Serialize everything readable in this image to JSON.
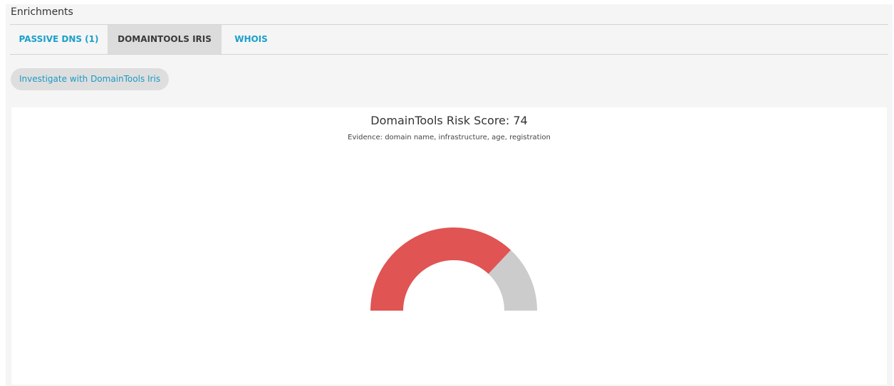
{
  "panel": {
    "title": "Enrichments"
  },
  "tabs": [
    {
      "label": "PASSIVE DNS (1)",
      "active": false
    },
    {
      "label": "DOMAINTOOLS IRIS",
      "active": true
    },
    {
      "label": "WHOIS",
      "active": false
    }
  ],
  "investigate_button": {
    "label": "Investigate with DomainTools Iris"
  },
  "risk": {
    "title": "DomainTools Risk Score: 74",
    "evidence": "Evidence: domain name, infrastructure, age, registration",
    "score": 74,
    "max": 100,
    "colors": {
      "fill": "#e05454",
      "track": "#cccccc"
    }
  }
}
